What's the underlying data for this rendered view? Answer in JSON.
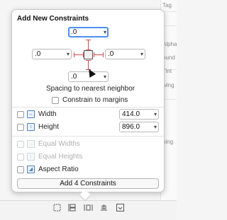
{
  "popover": {
    "title": "Add New Constraints",
    "spacing": {
      "top": ".0",
      "left": ".0",
      "right": ".0",
      "bottom": ".0",
      "caption": "Spacing to nearest neighbor"
    },
    "constrain_to_margins": "Constrain to margins",
    "options": {
      "width": {
        "label": "Width",
        "value": "414.0"
      },
      "height": {
        "label": "Height",
        "value": "896.0"
      },
      "equal_widths": "Equal Widths",
      "equal_heights": "Equal Heights",
      "aspect_ratio": "Aspect Ratio"
    },
    "add_button": "Add 4 Constraints"
  },
  "background": {
    "side_texts": [
      "Tag",
      "Alpha",
      "ound",
      "Tint",
      "wing",
      "hing"
    ]
  },
  "icons": {
    "dropdown": "chevron-down-icon",
    "cursor": "mouse-pointer-icon"
  },
  "colors": {
    "focus_ring": "#4c8ff0",
    "constraint_strut": "#d14a4a",
    "icon_accent": "#4a7fc1"
  }
}
